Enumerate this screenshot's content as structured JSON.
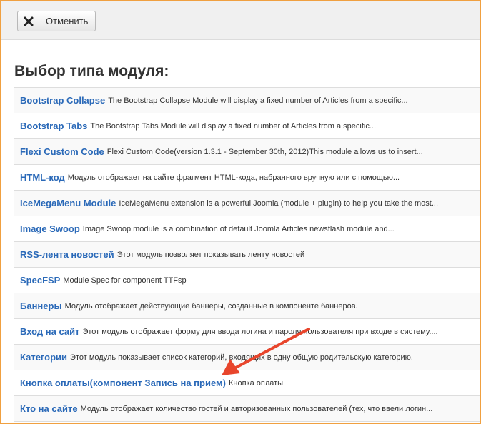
{
  "toolbar": {
    "cancel_label": "Отменить",
    "cancel_icon": "close-icon"
  },
  "page_title": "Выбор типа модуля:",
  "modules": [
    {
      "name": "Bootstrap Collapse",
      "description": "The Bootstrap Collapse Module will display a fixed number of Articles from a specific..."
    },
    {
      "name": "Bootstrap Tabs",
      "description": "The Bootstrap Tabs Module will display a fixed number of Articles from a specific..."
    },
    {
      "name": "Flexi Custom Code",
      "description": "Flexi Custom Code(version 1.3.1 - September 30th, 2012)This module allows us to insert..."
    },
    {
      "name": "HTML-код",
      "description": "Модуль отображает на сайте фрагмент HTML-кода, набранного вручную или с помощью..."
    },
    {
      "name": "IceMegaMenu Module",
      "description": "IceMegaMenu extension is a powerful Joomla (module + plugin) to help you take the most..."
    },
    {
      "name": "Image Swoop",
      "description": "Image Swoop module is a combination of default Joomla Articles newsflash module and..."
    },
    {
      "name": "RSS-лента новостей",
      "description": "Этот модуль позволяет показывать ленту новостей"
    },
    {
      "name": "SpecFSP",
      "description": "Module Spec for component TTFsp"
    },
    {
      "name": "Баннеры",
      "description": "Модуль отображает действующие баннеры, созданные в компоненте баннеров."
    },
    {
      "name": "Вход на сайт",
      "description": "Этот модуль отображает форму для ввода логина и пароля пользователя при входе в систему...."
    },
    {
      "name": "Категории",
      "description": "Этот модуль показывает список категорий, входящих в одну общую родительскую категорию."
    },
    {
      "name": "Кнопка оплаты(компонент Запись на прием)",
      "description": "Кнопка оплаты"
    },
    {
      "name": "Кто на сайте",
      "description": "Модуль отображает количество гостей и авторизованных пользователей (тех, что ввели логин..."
    }
  ],
  "colors": {
    "link": "#2a69b8",
    "arrow": "#e8452c",
    "frame": "#f0a040"
  }
}
